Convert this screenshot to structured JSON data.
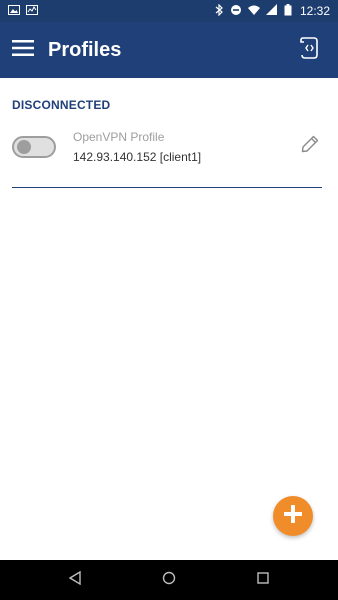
{
  "status_bar": {
    "time": "12:32",
    "icons": [
      "image-icon",
      "activity-icon",
      "bluetooth-icon",
      "dnd-icon",
      "wifi-icon",
      "signal-icon",
      "battery-icon"
    ]
  },
  "app_bar": {
    "title": "Profiles",
    "menu_icon": "hamburger-menu-icon",
    "import_icon": "import-file-icon"
  },
  "section": {
    "status_label": "DISCONNECTED"
  },
  "profiles": [
    {
      "name": "OpenVPN Profile",
      "server": "142.93.140.152 [client1]",
      "connected": false
    }
  ],
  "fab": {
    "icon": "plus-icon"
  },
  "nav": {
    "icons": [
      "back-icon",
      "home-icon",
      "recents-icon"
    ]
  },
  "colors": {
    "app_bar": "#1f4078",
    "status_bar": "#1c3d6e",
    "accent": "#f08c2a",
    "toggle_off": "#9e9e9e"
  }
}
